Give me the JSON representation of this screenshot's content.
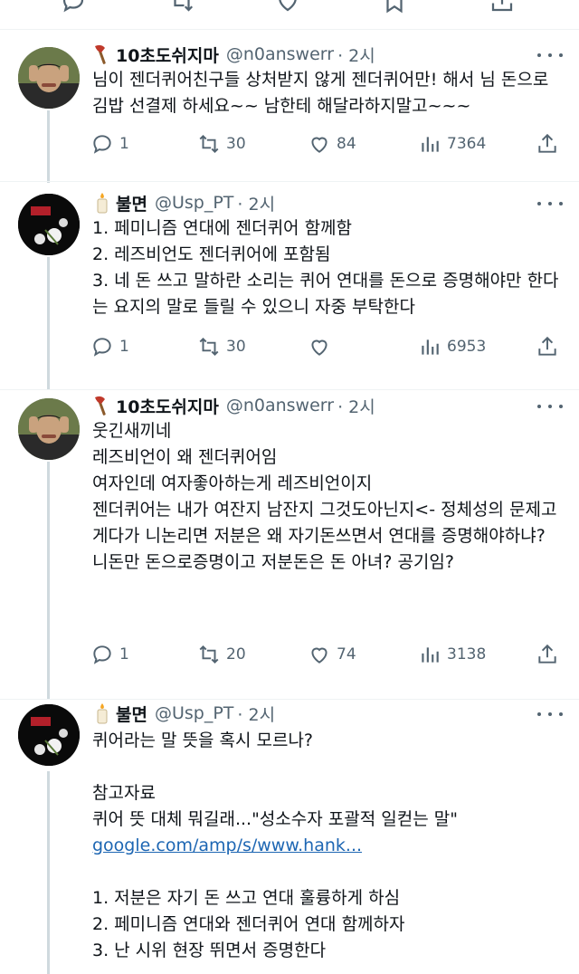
{
  "top_actions": [
    "reply-icon",
    "retweet-icon",
    "like-icon",
    "bookmark-icon",
    "share-icon"
  ],
  "tweets": [
    {
      "display_name": "10초도쉬지마",
      "name_emoji": "axe",
      "handle": "@n0answerr",
      "time": "· 2시",
      "text": "님이 젠더퀴어친구들 상처받지 않게 젠더퀴어만! 해서 님 돈으로 김밥 선결제 하세요~~ 남한테 해달라하지말고~~~",
      "replies": "1",
      "retweets": "30",
      "likes": "84",
      "views": "7364"
    },
    {
      "display_name": "불면",
      "name_emoji": "candle",
      "handle": "@Usp_PT",
      "time": "· 2시",
      "text": "1. 페미니즘 연대에 젠더퀴어 함께함\n2. 레즈비언도 젠더퀴어에 포함됨\n3. 네 돈 쓰고 말하란 소리는 퀴어 연대를 돈으로 증명해야만 한다는 요지의 말로 들릴 수 있으니 자중 부탁한다",
      "replies": "1",
      "retweets": "30",
      "likes": "",
      "views": "6953"
    },
    {
      "display_name": "10초도쉬지마",
      "name_emoji": "axe",
      "handle": "@n0answerr",
      "time": "· 2시",
      "text": "웃긴새끼네\n레즈비언이 왜 젠더퀴어임\n여자인데 여자좋아하는게 레즈비언이지\n젠더퀴어는 내가 여잔지 남잔지 그것도아닌지<- 정체성의 문제고\n게다가 니논리면 저분은 왜 자기돈쓰면서 연대를 증명해야하냐? 니돈만 돈으로증명이고 저분돈은 돈 아녀? 공기임?",
      "replies": "1",
      "retweets": "20",
      "likes": "74",
      "views": "3138"
    },
    {
      "display_name": "불면",
      "name_emoji": "candle",
      "handle": "@Usp_PT",
      "time": "· 2시",
      "text_before_link": "퀴어라는 말 뜻을 혹시 모르나?\n\n참고자료\n퀴어 뜻 대체 뭐길래...\"성소수자 포괄적 일컫는 말\"\n",
      "link": "google.com/amp/s/www.hank...",
      "text_after_link": "\n\n1. 저분은 자기 돈 쓰고 연대 훌륭하게 하심\n2. 페미니즘 연대와 젠더퀴어 연대 함께하자\n3. 난 시위 현장 뛰면서 증명한다"
    }
  ]
}
